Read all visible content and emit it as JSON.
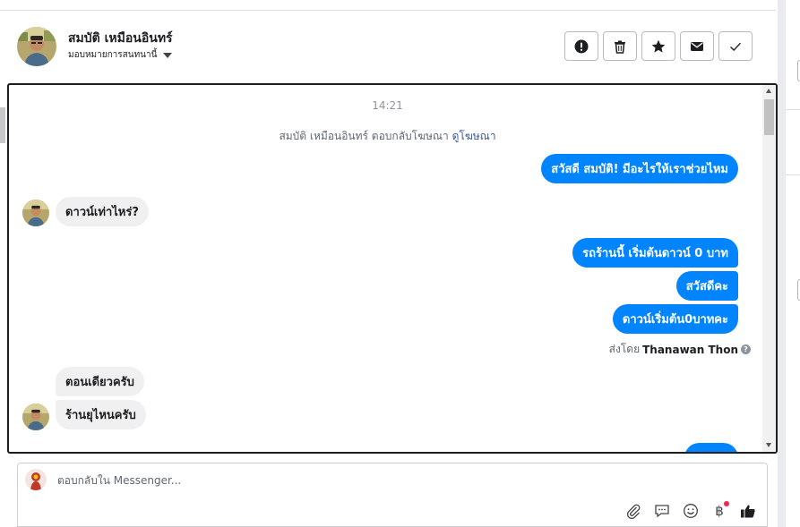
{
  "contact": {
    "name": "สมบัติ เหมือนอินทร์",
    "assign_label": "มอบหมายการสนทนานี้"
  },
  "actions": [
    {
      "name": "spam-button",
      "icon": "alert-icon"
    },
    {
      "name": "delete-button",
      "icon": "trash-icon"
    },
    {
      "name": "star-button",
      "icon": "star-icon"
    },
    {
      "name": "mark-unread-button",
      "icon": "envelope-icon"
    },
    {
      "name": "mark-done-button",
      "icon": "check-icon"
    }
  ],
  "chat": {
    "time": "14:21",
    "system": {
      "text": "สมบัติ เหมือนอินทร์ ตอบกลับโฆษณา",
      "link": "ดูโฆษณา"
    },
    "messages": {
      "out_1": "สวัสดี สมบัติ! มีอะไรให้เราช่วยไหม",
      "in_1": "ดาวน์เท่าไหร่?",
      "out_2": "รถร้านนี้ เริ่มต้นดาวน์ 0 บาท",
      "out_3": "สวัสดีคะ",
      "out_4": "ดาวน์เริ่มต้น0บาทคะ",
      "in_2": "ตอนเดียวครับ",
      "in_3": "ร้านยุไหนครับ"
    },
    "sent_by": {
      "prefix": "ส่งโดย",
      "name": "Thanawan Thon",
      "help": "?"
    }
  },
  "composer": {
    "placeholder": "ตอบกลับใน Messenger...",
    "tools": [
      "paperclip-icon",
      "saved-reply-icon",
      "emoji-icon",
      "payment-icon",
      "like-icon"
    ],
    "payment_symbol": "฿"
  },
  "colors": {
    "bubble_out": "#0084ff",
    "bubble_in": "#f0f0f0",
    "link": "#385898"
  }
}
